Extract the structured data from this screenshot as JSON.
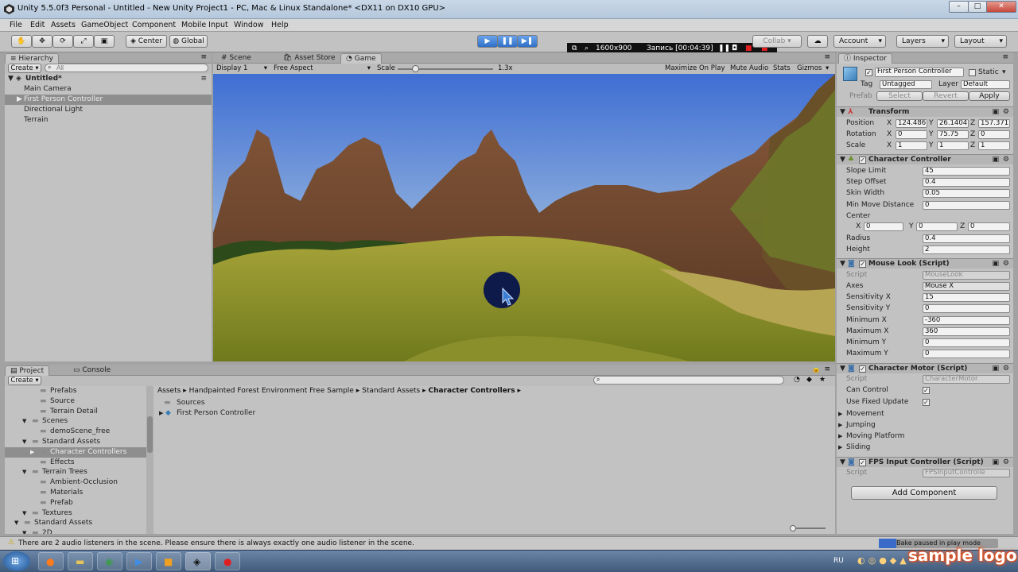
{
  "window": {
    "title": "Unity 5.5.0f3 Personal - Untitled - New Unity Project1 - PC, Mac & Linux Standalone* <DX11 on DX10 GPU>",
    "controls": {
      "minimize": "–",
      "maximize": "□",
      "close": "✕"
    }
  },
  "menu": [
    "File",
    "Edit",
    "Assets",
    "GameObject",
    "Component",
    "Mobile Input",
    "Window",
    "Help"
  ],
  "toolbar": {
    "pivot_center": "Center",
    "pivot_global": "Global",
    "collab": "Collab ▾",
    "account": "Account",
    "layers": "Layers",
    "layout": "Layout"
  },
  "recorder": {
    "resolution": "1600x900",
    "status": "Запись [00:04:39]"
  },
  "hierarchy": {
    "tab": "Hierarchy",
    "create": "Create",
    "search_placeholder": "All",
    "scene": "Untitled*",
    "items": [
      "Main Camera",
      "First Person Controller",
      "Directional Light",
      "Terrain"
    ]
  },
  "viewtabs": {
    "scene": "Scene",
    "asset_store": "Asset Store",
    "game": "Game"
  },
  "gamebar": {
    "display": "Display 1",
    "aspect": "Free Aspect",
    "scale_label": "Scale",
    "scale_value": "1.3x",
    "maximize": "Maximize On Play",
    "mute": "Mute Audio",
    "stats": "Stats",
    "gizmos": "Gizmos"
  },
  "project": {
    "tab_project": "Project",
    "tab_console": "Console",
    "create": "Create",
    "tree": [
      {
        "label": "Prefabs",
        "indent": 2
      },
      {
        "label": "Source",
        "indent": 2
      },
      {
        "label": "Terrain Detail",
        "indent": 2
      },
      {
        "label": "Scenes",
        "indent": 1
      },
      {
        "label": "demoScene_free",
        "indent": 2
      },
      {
        "label": "Standard Assets",
        "indent": 1
      },
      {
        "label": "Character Controllers",
        "indent": 2,
        "selected": true
      },
      {
        "label": "Effects",
        "indent": 2
      },
      {
        "label": "Terrain Trees",
        "indent": 1
      },
      {
        "label": "Ambient-Occlusion",
        "indent": 2
      },
      {
        "label": "Materials",
        "indent": 2
      },
      {
        "label": "Prefab",
        "indent": 2
      },
      {
        "label": "Textures",
        "indent": 1
      },
      {
        "label": "Standard Assets",
        "indent": 0
      },
      {
        "label": "2D",
        "indent": 1
      }
    ],
    "breadcrumb": [
      "Assets",
      "Handpainted Forest Environment Free Sample",
      "Standard Assets",
      "Character Controllers"
    ],
    "files": [
      "Sources",
      "First Person Controller"
    ]
  },
  "inspector": {
    "tab": "Inspector",
    "object_name": "First Person Controller",
    "static": "Static",
    "tag_label": "Tag",
    "tag_value": "Untagged",
    "layer_label": "Layer",
    "layer_value": "Default",
    "prefab_label": "Prefab",
    "prefab_select": "Select",
    "prefab_revert": "Revert",
    "prefab_apply": "Apply",
    "transform": {
      "title": "Transform",
      "position": {
        "label": "Position",
        "x": "124.486",
        "y": "26.1404",
        "z": "157.371"
      },
      "rotation": {
        "label": "Rotation",
        "x": "0",
        "y": "75.75",
        "z": "0"
      },
      "scale": {
        "label": "Scale",
        "x": "1",
        "y": "1",
        "z": "1"
      }
    },
    "character_controller": {
      "title": "Character Controller",
      "fields": [
        {
          "label": "Slope Limit",
          "value": "45"
        },
        {
          "label": "Step Offset",
          "value": "0.4"
        },
        {
          "label": "Skin Width",
          "value": "0.05"
        },
        {
          "label": "Min Move Distance",
          "value": "0"
        }
      ],
      "center_label": "Center",
      "center": {
        "x": "0",
        "y": "0",
        "z": "0"
      },
      "radius_label": "Radius",
      "radius": "0.4",
      "height_label": "Height",
      "height": "2"
    },
    "mouse_look": {
      "title": "Mouse Look (Script)",
      "script_label": "Script",
      "script": "MouseLook",
      "axes_label": "Axes",
      "axes": "Mouse X",
      "fields": [
        {
          "label": "Sensitivity X",
          "value": "15"
        },
        {
          "label": "Sensitivity Y",
          "value": "0"
        },
        {
          "label": "Minimum X",
          "value": "-360"
        },
        {
          "label": "Maximum X",
          "value": "360"
        },
        {
          "label": "Minimum Y",
          "value": "0"
        },
        {
          "label": "Maximum Y",
          "value": "0"
        }
      ]
    },
    "character_motor": {
      "title": "Character Motor (Script)",
      "script_label": "Script",
      "script": "CharacterMotor",
      "can_control": "Can Control",
      "use_fixed_update": "Use Fixed Update",
      "foldouts": [
        "Movement",
        "Jumping",
        "Moving Platform",
        "Sliding"
      ]
    },
    "fps_input": {
      "title": "FPS Input Controller (Script)",
      "script_label": "Script",
      "script": "FPSInputControlle"
    },
    "add_component": "Add Component"
  },
  "status": {
    "message": "There are 2 audio listeners in the scene. Please ensure there is always exactly one audio listener in the scene.",
    "bake": "Bake paused in play mode"
  },
  "taskbar": {
    "lang": "RU",
    "watermark": "sample logo"
  },
  "colors": {
    "play_active": "#3d7fd6",
    "selection": "#8e8e8e",
    "panel": "#c2c2c2"
  }
}
